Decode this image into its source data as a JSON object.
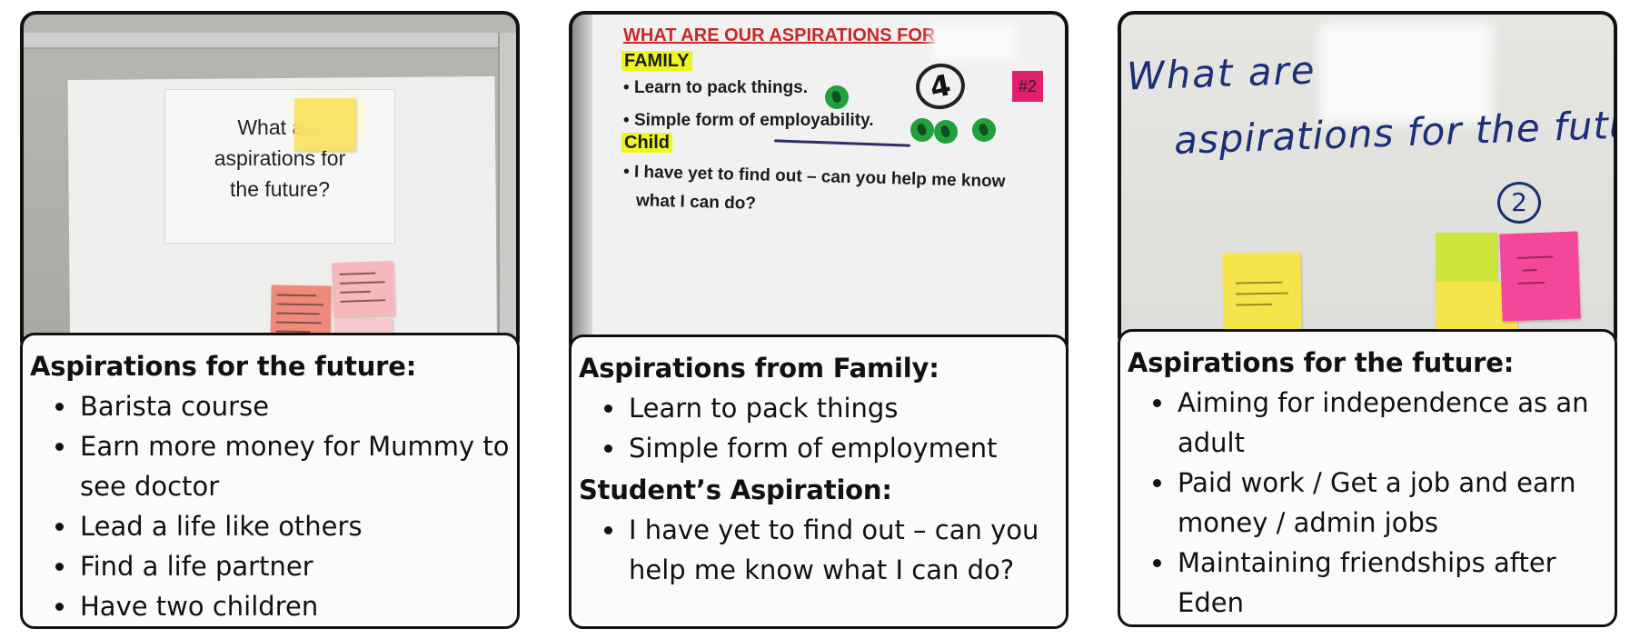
{
  "panels": [
    {
      "photo": {
        "sign_lines": [
          "What are",
          "aspirations for",
          "the future?"
        ],
        "board_question": "What are"
      },
      "caption_sections": [
        {
          "heading": "Aspirations for the future:",
          "items": [
            "Barista course",
            "Earn more money for Mummy to see doctor",
            "Lead a life like others",
            "Find a life partner",
            "Have two children"
          ]
        }
      ]
    },
    {
      "photo": {
        "title": "WHAT ARE OUR ASPIRATIONS FOR",
        "family_label": "FAMILY",
        "family_items": [
          "Learn to pack things.",
          "Simple form of employability."
        ],
        "child_label": "Child",
        "child_items": [
          "I have yet to find out – can you help me know",
          "what I can do?"
        ],
        "tag": "#2",
        "circled_number": "4"
      },
      "caption_sections": [
        {
          "heading": "Aspirations from Family:",
          "items": [
            "Learn to pack things",
            "Simple form of employment"
          ]
        },
        {
          "heading": "Student’s Aspiration:",
          "items": [
            "I have yet to find out – can you help me know what I can do?"
          ]
        }
      ]
    },
    {
      "photo": {
        "line1": "What are",
        "line2": "aspirations for the future?",
        "circled_number": "2"
      },
      "caption_sections": [
        {
          "heading": "Aspirations for the future:",
          "items": [
            "Aiming for independence as an adult",
            "Paid work / Get a job and earn money / admin jobs",
            "Maintaining friendships after Eden"
          ]
        }
      ]
    }
  ],
  "colors": {
    "border": "#111111",
    "sticky_pink": "#f6b7bd",
    "sticky_salmon": "#ef8a7a",
    "sticky_yellow": "#f7e34c",
    "sticky_hotpink": "#f4479a",
    "sticky_lime": "#cfe73a",
    "highlight_yellow": "#eef51f",
    "title_red": "#c62828",
    "marker_blue": "#1b2f77"
  }
}
